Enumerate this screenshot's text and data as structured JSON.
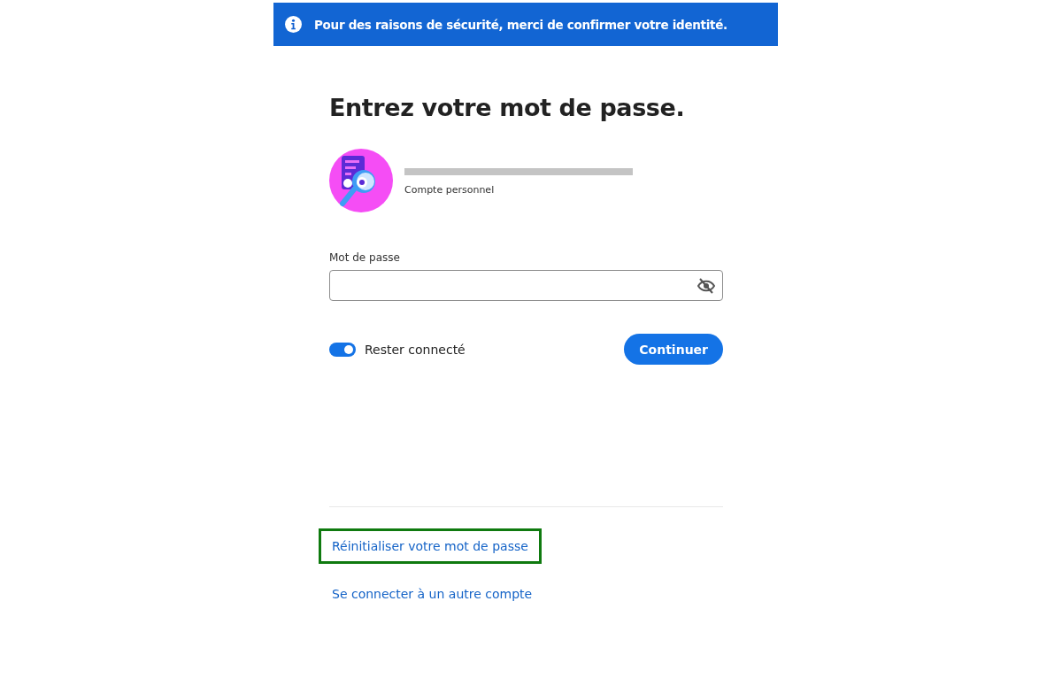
{
  "banner": {
    "message": "Pour des raisons de sécurité, merci de confirmer votre identité."
  },
  "heading": "Entrez votre mot de passe.",
  "account": {
    "email_redacted": true,
    "type": "Compte personnel"
  },
  "password_field": {
    "label": "Mot de passe"
  },
  "stay_signed_in": {
    "label": "Rester connecté",
    "on": true
  },
  "continue_button": "Continuer",
  "links": [
    {
      "label": "Réinitialiser votre mot de passe",
      "highlighted": true
    },
    {
      "label": "Se connecter à un autre compte",
      "highlighted": false
    }
  ]
}
